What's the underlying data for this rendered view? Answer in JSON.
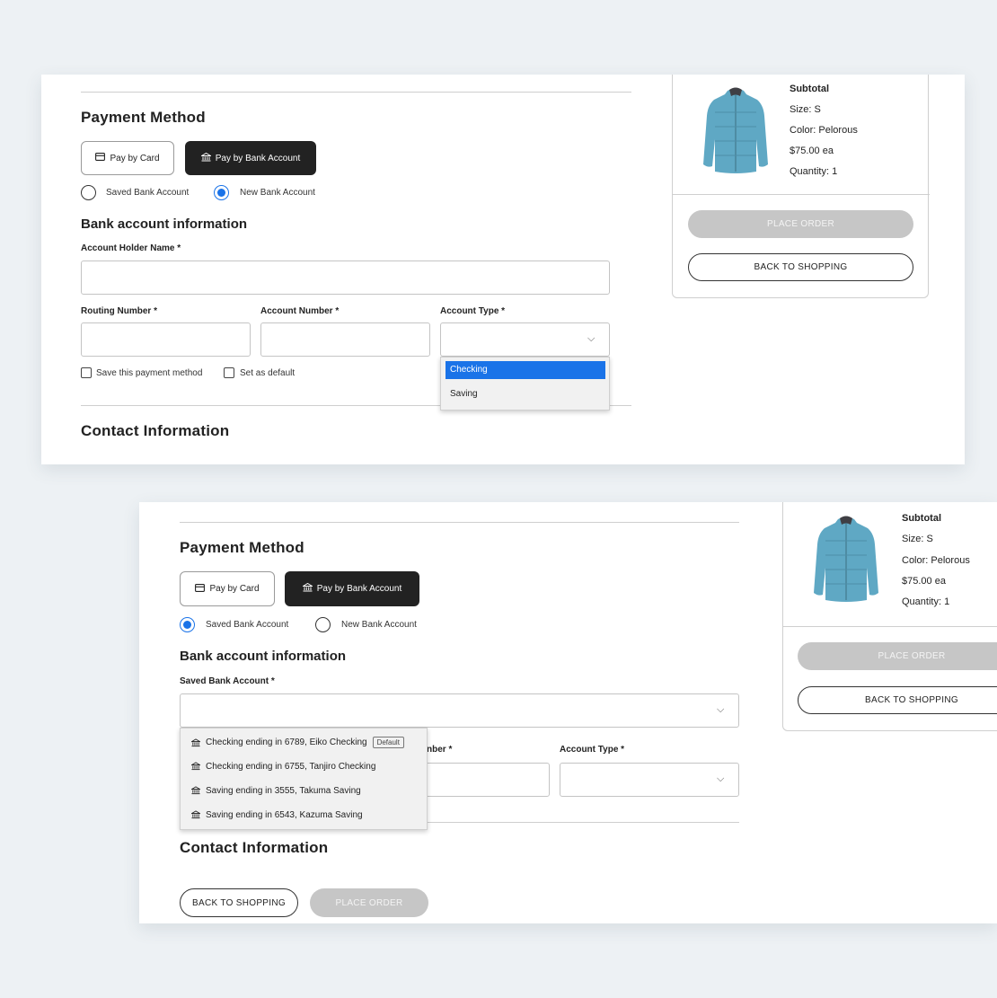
{
  "payment": {
    "title": "Payment Method",
    "pay_by_card": "Pay by Card",
    "pay_by_bank": "Pay by Bank Account",
    "saved_bank_radio": "Saved Bank Account",
    "new_bank_radio": "New Bank Account",
    "bank_info_title": "Bank account information",
    "account_holder_label": "Account Holder Name *",
    "routing_label": "Routing Number *",
    "account_number_label": "Account Number *",
    "account_type_label": "Account Type *",
    "save_method": "Save this payment method",
    "set_default": "Set as default",
    "account_type_options": [
      "Checking",
      "Saving"
    ],
    "account_type_highlighted": "Checking",
    "contact_title": "Contact Information",
    "saved_bank_label": "Saved Bank Account *",
    "account_number_label_partial": "nber *",
    "saved_accounts": [
      {
        "label": "Checking ending in 6789, Eiko Checking",
        "badge": "Default"
      },
      {
        "label": "Checking ending in 6755, Tanjiro Checking",
        "badge": ""
      },
      {
        "label": "Saving ending in 3555, Takuma Saving",
        "badge": ""
      },
      {
        "label": "Saving ending in 6543, Kazuma Saving",
        "badge": ""
      }
    ]
  },
  "summary": {
    "subtotal": "Subtotal",
    "size": "Size: S",
    "color": "Color: Pelorous",
    "price": "$75.00 ea",
    "quantity": "Quantity: 1",
    "place_order": "PLACE ORDER",
    "back_to_shopping": "BACK TO SHOPPING"
  },
  "colors": {
    "accent": "#1a73e8",
    "dark_button": "#222222",
    "disabled_button": "#c6c6c6",
    "jacket": "#5fa8c4"
  }
}
